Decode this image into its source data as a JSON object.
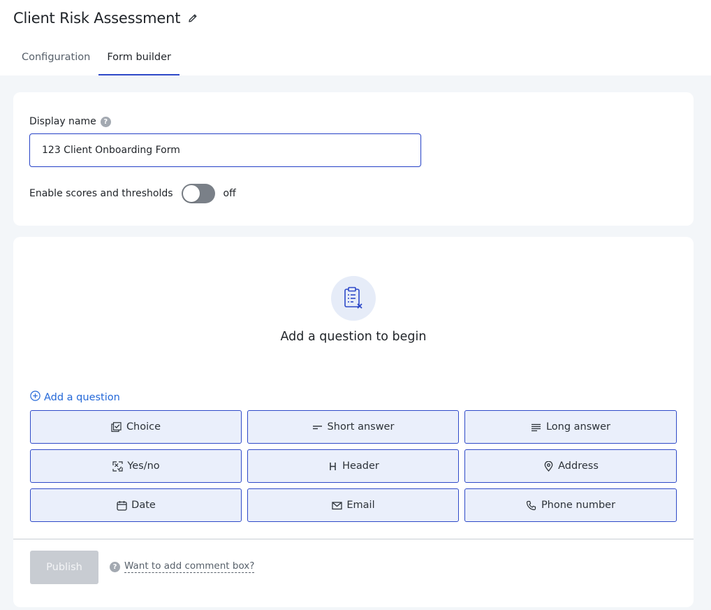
{
  "header": {
    "title": "Client Risk Assessment",
    "tabs": [
      {
        "label": "Configuration",
        "active": false
      },
      {
        "label": "Form builder",
        "active": true
      }
    ]
  },
  "settings": {
    "display_name_label": "Display name",
    "display_name_value": "123 Client Onboarding Form",
    "scores_label": "Enable scores and thresholds",
    "scores_state": "off"
  },
  "builder": {
    "empty_title": "Add a question to begin",
    "add_question_label": "Add a question",
    "question_types": [
      {
        "label": "Choice",
        "icon": "checkbox-list-icon"
      },
      {
        "label": "Short answer",
        "icon": "short-answer-icon"
      },
      {
        "label": "Long answer",
        "icon": "long-answer-icon"
      },
      {
        "label": "Yes/no",
        "icon": "yes-no-icon"
      },
      {
        "label": "Header",
        "icon": "header-icon"
      },
      {
        "label": "Address",
        "icon": "location-pin-icon"
      },
      {
        "label": "Date",
        "icon": "calendar-icon"
      },
      {
        "label": "Email",
        "icon": "envelope-icon"
      },
      {
        "label": "Phone number",
        "icon": "phone-icon"
      }
    ]
  },
  "footer": {
    "publish_label": "Publish",
    "comment_hint": "Want to add comment box?"
  },
  "colors": {
    "accent": "#2e49c8",
    "link": "#2468d8",
    "button_fill": "#eaeffb",
    "page_bg": "#f3f6f9",
    "toggle_off": "#7a8088",
    "publish_disabled": "#c8ccd2"
  }
}
